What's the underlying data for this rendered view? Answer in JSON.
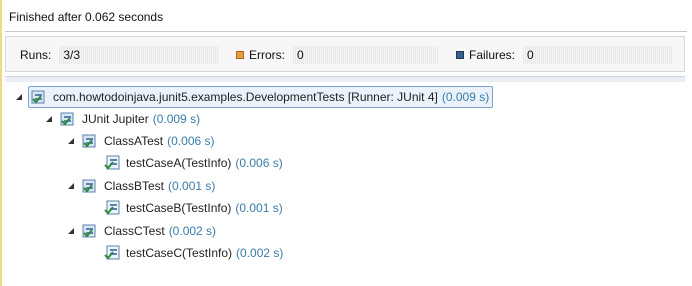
{
  "status": {
    "header": "Finished after 0.062 seconds"
  },
  "counters": {
    "runs": {
      "label": "Runs:",
      "value": "3/3"
    },
    "errors": {
      "label": "Errors:",
      "value": "0",
      "icon": "error-icon"
    },
    "failures": {
      "label": "Failures:",
      "value": "0",
      "icon": "failure-icon"
    }
  },
  "colors": {
    "time": "#3a7ca8",
    "selection": "#eaf2fb",
    "error": "#e89a4a",
    "failure": "#3b5f8c"
  },
  "tree": {
    "root": {
      "name": "com.howtodoinjava.junit5.examples.DevelopmentTests [Runner: JUnit 4]",
      "time": "(0.009 s)",
      "icon": "test-suite-icon"
    },
    "jupiter": {
      "name": "JUnit Jupiter",
      "time": "(0.009 s)",
      "icon": "test-suite-icon"
    },
    "classA": {
      "name": "ClassATest",
      "time": "(0.006 s)",
      "icon": "test-suite-icon"
    },
    "caseA": {
      "name": "testCaseA(TestInfo)",
      "time": "(0.006 s)",
      "icon": "test-case-icon"
    },
    "classB": {
      "name": "ClassBTest",
      "time": "(0.001 s)",
      "icon": "test-suite-icon"
    },
    "caseB": {
      "name": "testCaseB(TestInfo)",
      "time": "(0.001 s)",
      "icon": "test-case-icon"
    },
    "classC": {
      "name": "ClassCTest",
      "time": "(0.002 s)",
      "icon": "test-suite-icon"
    },
    "caseC": {
      "name": "testCaseC(TestInfo)",
      "time": "(0.002 s)",
      "icon": "test-case-icon"
    }
  }
}
